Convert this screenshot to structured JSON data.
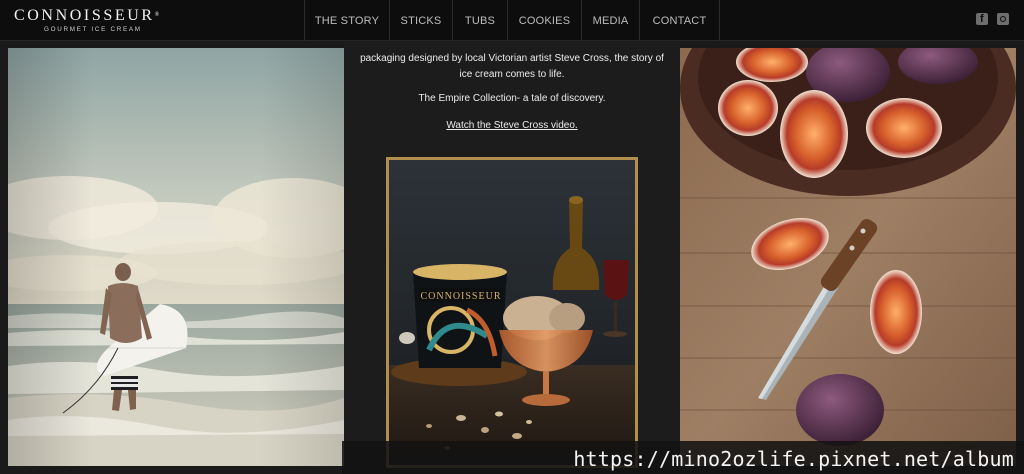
{
  "brand": {
    "name": "CONNOISSEUR",
    "mark": "®",
    "subtitle": "GOURMET ICE CREAM"
  },
  "nav": {
    "items": [
      "THE STORY",
      "STICKS",
      "TUBS",
      "COOKIES",
      "MEDIA",
      "CONTACT"
    ]
  },
  "social": {
    "facebook": "facebook-icon",
    "instagram": "instagram-icon"
  },
  "content": {
    "story_text": "packaging designed by local Victorian artist Steve Cross, the story of ice cream comes to life.",
    "tagline": "The Empire Collection- a tale of discovery.",
    "video_link": "Watch the Steve Cross video."
  },
  "product": {
    "tub_label": "CONNOISSEUR"
  },
  "watermark": {
    "text": "https://mino2ozlife.pixnet.net/album"
  },
  "colors": {
    "topbar": "#0d0d0d",
    "background": "#1c1c1c",
    "frame_gold": "#b38f4e",
    "nav_text": "#bdbdbd"
  }
}
